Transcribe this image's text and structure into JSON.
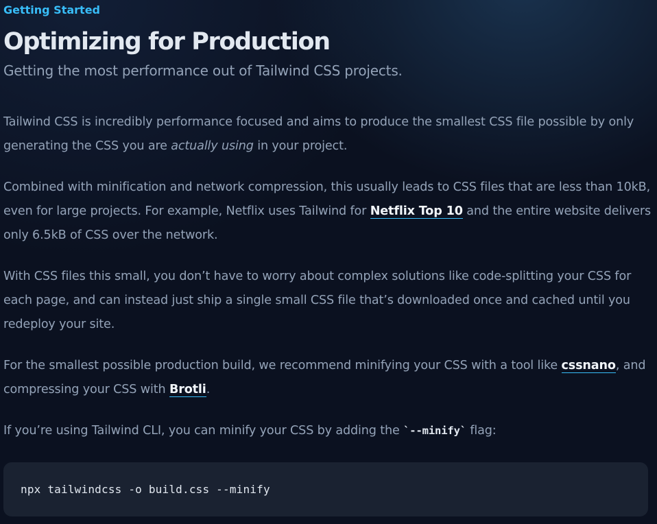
{
  "header": {
    "eyebrow": "Getting Started",
    "title": "Optimizing for Production",
    "subtitle": "Getting the most performance out of Tailwind CSS projects."
  },
  "content": {
    "p1": {
      "before": "Tailwind CSS is incredibly performance focused and aims to produce the smallest CSS file possible by only generating the CSS you are ",
      "emphasis": "actually using",
      "after": " in your project."
    },
    "p2": {
      "before": "Combined with minification and network compression, this usually leads to CSS files that are less than 10kB, even for large projects. For example, Netflix uses Tailwind for ",
      "link": "Netflix Top 10",
      "after": " and the entire website delivers only 6.5kB of CSS over the network."
    },
    "p3": {
      "text": "With CSS files this small, you don’t have to worry about complex solutions like code-splitting your CSS for each page, and can instead just ship a single small CSS file that’s downloaded once and cached until you redeploy your site."
    },
    "p4": {
      "before": "For the smallest possible production build, we recommend minifying your CSS with a tool like ",
      "link1": "cssnano",
      "middle": ", and compressing your CSS with ",
      "link2": "Brotli",
      "after": "."
    },
    "p5": {
      "before": "If you’re using Tailwind CLI, you can minify your CSS by adding the ",
      "code": "`--minify`",
      "after": " flag:"
    }
  },
  "code_block": {
    "command": "npx tailwindcss -o build.css --minify"
  }
}
